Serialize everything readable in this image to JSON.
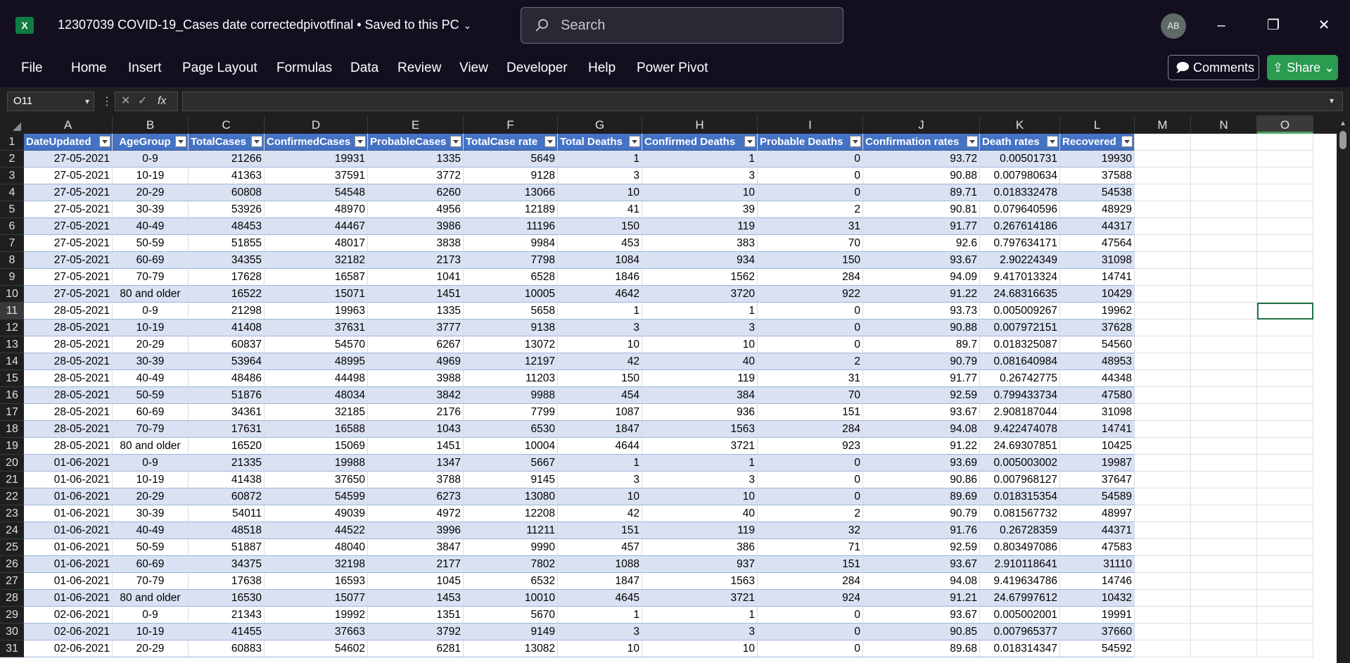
{
  "window": {
    "app_icon": "excel-icon",
    "title": "12307039 COVID-19_Cases date correctedpivotfinal • Saved to this PC",
    "search_placeholder": "Search",
    "avatar_initials": "AB"
  },
  "menu": {
    "items": [
      "File",
      "Home",
      "Insert",
      "Page Layout",
      "Formulas",
      "Data",
      "Review",
      "View",
      "Developer",
      "Help",
      "Power Pivot"
    ],
    "comments_label": "Comments",
    "share_label": "Share"
  },
  "formula_bar": {
    "name_box": "O11",
    "fx_label": "fx",
    "formula": ""
  },
  "colors": {
    "header_fill": "#4472c4",
    "band_fill": "#d9e1f2",
    "share_green": "#2a9b4f",
    "selection_green": "#217346"
  },
  "sheet": {
    "column_letters": [
      "A",
      "B",
      "C",
      "D",
      "E",
      "F",
      "G",
      "H",
      "I",
      "J",
      "K",
      "L",
      "M",
      "N",
      "O"
    ],
    "selected_cell": "O11",
    "headers": [
      "DateUpdated",
      "AgeGroup",
      "TotalCases",
      "ConfirmedCases",
      "ProbableCases",
      "TotalCase rate",
      "Total Deaths",
      "Confirmed Deaths",
      "Probable Deaths",
      "Confirmation rates",
      "Death rates",
      "Recovered"
    ],
    "rows": [
      [
        "27-05-2021",
        "0-9",
        "21266",
        "19931",
        "1335",
        "5649",
        "1",
        "1",
        "0",
        "93.72",
        "0.00501731",
        "19930"
      ],
      [
        "27-05-2021",
        "10-19",
        "41363",
        "37591",
        "3772",
        "9128",
        "3",
        "3",
        "0",
        "90.88",
        "0.007980634",
        "37588"
      ],
      [
        "27-05-2021",
        "20-29",
        "60808",
        "54548",
        "6260",
        "13066",
        "10",
        "10",
        "0",
        "89.71",
        "0.018332478",
        "54538"
      ],
      [
        "27-05-2021",
        "30-39",
        "53926",
        "48970",
        "4956",
        "12189",
        "41",
        "39",
        "2",
        "90.81",
        "0.079640596",
        "48929"
      ],
      [
        "27-05-2021",
        "40-49",
        "48453",
        "44467",
        "3986",
        "11196",
        "150",
        "119",
        "31",
        "91.77",
        "0.267614186",
        "44317"
      ],
      [
        "27-05-2021",
        "50-59",
        "51855",
        "48017",
        "3838",
        "9984",
        "453",
        "383",
        "70",
        "92.6",
        "0.797634171",
        "47564"
      ],
      [
        "27-05-2021",
        "60-69",
        "34355",
        "32182",
        "2173",
        "7798",
        "1084",
        "934",
        "150",
        "93.67",
        "2.90224349",
        "31098"
      ],
      [
        "27-05-2021",
        "70-79",
        "17628",
        "16587",
        "1041",
        "6528",
        "1846",
        "1562",
        "284",
        "94.09",
        "9.417013324",
        "14741"
      ],
      [
        "27-05-2021",
        "80 and older",
        "16522",
        "15071",
        "1451",
        "10005",
        "4642",
        "3720",
        "922",
        "91.22",
        "24.68316635",
        "10429"
      ],
      [
        "28-05-2021",
        "0-9",
        "21298",
        "19963",
        "1335",
        "5658",
        "1",
        "1",
        "0",
        "93.73",
        "0.005009267",
        "19962"
      ],
      [
        "28-05-2021",
        "10-19",
        "41408",
        "37631",
        "3777",
        "9138",
        "3",
        "3",
        "0",
        "90.88",
        "0.007972151",
        "37628"
      ],
      [
        "28-05-2021",
        "20-29",
        "60837",
        "54570",
        "6267",
        "13072",
        "10",
        "10",
        "0",
        "89.7",
        "0.018325087",
        "54560"
      ],
      [
        "28-05-2021",
        "30-39",
        "53964",
        "48995",
        "4969",
        "12197",
        "42",
        "40",
        "2",
        "90.79",
        "0.081640984",
        "48953"
      ],
      [
        "28-05-2021",
        "40-49",
        "48486",
        "44498",
        "3988",
        "11203",
        "150",
        "119",
        "31",
        "91.77",
        "0.26742775",
        "44348"
      ],
      [
        "28-05-2021",
        "50-59",
        "51876",
        "48034",
        "3842",
        "9988",
        "454",
        "384",
        "70",
        "92.59",
        "0.799433734",
        "47580"
      ],
      [
        "28-05-2021",
        "60-69",
        "34361",
        "32185",
        "2176",
        "7799",
        "1087",
        "936",
        "151",
        "93.67",
        "2.908187044",
        "31098"
      ],
      [
        "28-05-2021",
        "70-79",
        "17631",
        "16588",
        "1043",
        "6530",
        "1847",
        "1563",
        "284",
        "94.08",
        "9.422474078",
        "14741"
      ],
      [
        "28-05-2021",
        "80 and older",
        "16520",
        "15069",
        "1451",
        "10004",
        "4644",
        "3721",
        "923",
        "91.22",
        "24.69307851",
        "10425"
      ],
      [
        "01-06-2021",
        "0-9",
        "21335",
        "19988",
        "1347",
        "5667",
        "1",
        "1",
        "0",
        "93.69",
        "0.005003002",
        "19987"
      ],
      [
        "01-06-2021",
        "10-19",
        "41438",
        "37650",
        "3788",
        "9145",
        "3",
        "3",
        "0",
        "90.86",
        "0.007968127",
        "37647"
      ],
      [
        "01-06-2021",
        "20-29",
        "60872",
        "54599",
        "6273",
        "13080",
        "10",
        "10",
        "0",
        "89.69",
        "0.018315354",
        "54589"
      ],
      [
        "01-06-2021",
        "30-39",
        "54011",
        "49039",
        "4972",
        "12208",
        "42",
        "40",
        "2",
        "90.79",
        "0.081567732",
        "48997"
      ],
      [
        "01-06-2021",
        "40-49",
        "48518",
        "44522",
        "3996",
        "11211",
        "151",
        "119",
        "32",
        "91.76",
        "0.26728359",
        "44371"
      ],
      [
        "01-06-2021",
        "50-59",
        "51887",
        "48040",
        "3847",
        "9990",
        "457",
        "386",
        "71",
        "92.59",
        "0.803497086",
        "47583"
      ],
      [
        "01-06-2021",
        "60-69",
        "34375",
        "32198",
        "2177",
        "7802",
        "1088",
        "937",
        "151",
        "93.67",
        "2.910118641",
        "31110"
      ],
      [
        "01-06-2021",
        "70-79",
        "17638",
        "16593",
        "1045",
        "6532",
        "1847",
        "1563",
        "284",
        "94.08",
        "9.419634786",
        "14746"
      ],
      [
        "01-06-2021",
        "80 and older",
        "16530",
        "15077",
        "1453",
        "10010",
        "4645",
        "3721",
        "924",
        "91.21",
        "24.67997612",
        "10432"
      ],
      [
        "02-06-2021",
        "0-9",
        "21343",
        "19992",
        "1351",
        "5670",
        "1",
        "1",
        "0",
        "93.67",
        "0.005002001",
        "19991"
      ],
      [
        "02-06-2021",
        "10-19",
        "41455",
        "37663",
        "3792",
        "9149",
        "3",
        "3",
        "0",
        "90.85",
        "0.007965377",
        "37660"
      ],
      [
        "02-06-2021",
        "20-29",
        "60883",
        "54602",
        "6281",
        "13082",
        "10",
        "10",
        "0",
        "89.68",
        "0.018314347",
        "54592"
      ]
    ]
  }
}
